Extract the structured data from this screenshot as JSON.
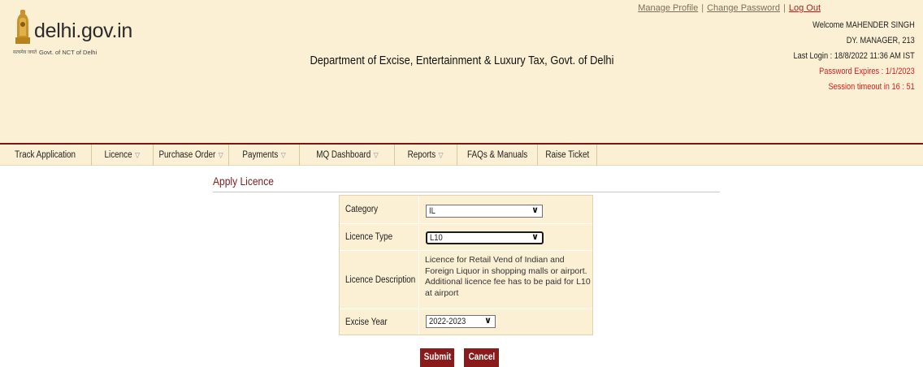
{
  "site": {
    "logo_text": "delhi.gov.in",
    "logo_hindi": "सत्यमेव जयते",
    "logo_sub": "Govt. of NCT of Delhi",
    "department_title": "Department of Excise, Entertainment & Luxury Tax, Govt. of Delhi"
  },
  "top_links": {
    "manage_profile": "Manage Profile",
    "change_password": "Change Password",
    "logout": "Log Out",
    "separator": "|"
  },
  "user": {
    "welcome": "Welcome MAHENDER SINGH",
    "designation": "DY. MANAGER, 213",
    "last_login": "Last Login : 18/8/2022 11:36 AM IST",
    "password_expires": "Password Expires : 1/1/2023",
    "session_timeout": "Session timeout in  16 : 51"
  },
  "nav": [
    {
      "label": "Track Application",
      "caret": false
    },
    {
      "label": "Licence",
      "caret": true
    },
    {
      "label": "Purchase Order",
      "caret": true
    },
    {
      "label": "Payments",
      "caret": true
    },
    {
      "label": "MQ Dashboard",
      "caret": true
    },
    {
      "label": "Reports",
      "caret": true
    },
    {
      "label": "FAQs & Manuals",
      "caret": false
    },
    {
      "label": "Raise Ticket",
      "caret": false
    }
  ],
  "page": {
    "heading": "Apply Licence"
  },
  "form": {
    "category_label": "Category",
    "category_value": "IL",
    "licence_type_label": "Licence Type",
    "licence_type_value": "L10",
    "description_label": "Licence Description",
    "description_text": "Licence for Retail Vend of Indian and Foreign Liquor in shopping malls or airport. Additional licence fee has to be paid for L10 at airport",
    "excise_year_label": "Excise Year",
    "excise_year_value": "2022-2023",
    "dropdown_arrow": "∨"
  },
  "buttons": {
    "submit": "Submit",
    "cancel": "Cancel"
  },
  "colors": {
    "header_bg": "#fbf0d4",
    "accent_maroon": "#8b1a1a",
    "alert_red": "#d41f1f"
  }
}
